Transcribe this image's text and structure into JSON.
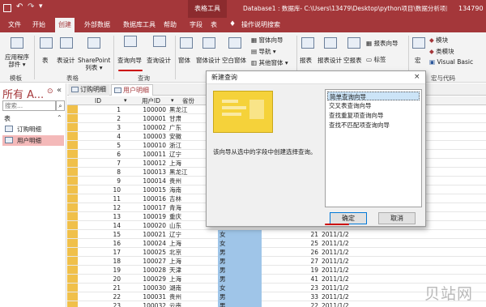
{
  "titlebar": {
    "context": "表格工具",
    "path": "Database1 : 数据库- C:\\Users\\13479\\Desktop\\python项目\\数据分析项目例子\\追...",
    "user": "134790"
  },
  "tabs": [
    "文件",
    "开始",
    "创建",
    "外部数据",
    "数据库工具",
    "帮助",
    "字段",
    "表",
    "操作说明搜索"
  ],
  "ribbon": {
    "app_parts": "应用程序\n部件 ▾",
    "table": "表",
    "table_design": "表设计",
    "sharepoint": "SharePoint\n列表 ▾",
    "query_wizard": "查询向导",
    "query_design": "查询设计",
    "form": "窗体",
    "form_design": "窗体设计",
    "blank_form": "空白窗体",
    "form_wizard": "窗体向导",
    "navigation": "导航 ▾",
    "other_forms": "其他窗体 ▾",
    "report": "报表",
    "report_design": "报表设计",
    "blank_report": "空报表",
    "report_wizard": "报表向导",
    "labels": "标签",
    "macro": "宏",
    "module": "模块",
    "class_module": "类模块",
    "vb": "Visual Basic",
    "groups": {
      "templates": "模板",
      "tables": "表格",
      "queries": "查询",
      "macros": "宏与代码"
    }
  },
  "nav": {
    "title": "所有 A...",
    "search_placeholder": "搜索...",
    "section": "表",
    "items": [
      "订购明细",
      "用户明细"
    ]
  },
  "doc_tabs": [
    "订购明细",
    "用户明细"
  ],
  "grid": {
    "headers": [
      "ID",
      "用户ID",
      "省份"
    ],
    "rows": [
      [
        "1",
        "100000",
        "黑龙江"
      ],
      [
        "2",
        "100001",
        "甘肃"
      ],
      [
        "3",
        "100002",
        "广东"
      ],
      [
        "4",
        "100003",
        "安徽"
      ],
      [
        "5",
        "100010",
        "浙江"
      ],
      [
        "6",
        "100011",
        "辽宁"
      ],
      [
        "7",
        "100012",
        "上海"
      ],
      [
        "8",
        "100013",
        "黑龙江"
      ],
      [
        "9",
        "100014",
        "贵州"
      ],
      [
        "10",
        "100015",
        "海南"
      ],
      [
        "11",
        "100016",
        "吉林"
      ],
      [
        "12",
        "100017",
        "青海"
      ],
      [
        "13",
        "100019",
        "重庆"
      ],
      [
        "14",
        "100020",
        "山东"
      ],
      [
        "15",
        "100021",
        "辽宁",
        "女",
        "21",
        "2011/1/2"
      ],
      [
        "16",
        "100024",
        "上海",
        "女",
        "25",
        "2011/1/2"
      ],
      [
        "17",
        "100025",
        "北京",
        "男",
        "26",
        "2011/1/2"
      ],
      [
        "18",
        "100027",
        "上海",
        "男",
        "27",
        "2011/1/2"
      ],
      [
        "19",
        "100028",
        "天津",
        "男",
        "19",
        "2011/1/2"
      ],
      [
        "20",
        "100029",
        "上海",
        "男",
        "41",
        "2011/1/2"
      ],
      [
        "21",
        "100030",
        "湖南",
        "女",
        "23",
        "2011/1/2"
      ],
      [
        "22",
        "100031",
        "贵州",
        "男",
        "33",
        "2011/1/2"
      ],
      [
        "23",
        "100032",
        "云南",
        "男",
        "22",
        "2011/1/2"
      ]
    ]
  },
  "dialog": {
    "title": "新建查询",
    "description": "该向导从选中的字段中创建选择查询。",
    "options": [
      "简单查询向导",
      "交叉表查询向导",
      "查找重复项查询向导",
      "查找不匹配项查询向导"
    ],
    "ok": "确定",
    "cancel": "取消"
  },
  "watermark": "贝站网"
}
